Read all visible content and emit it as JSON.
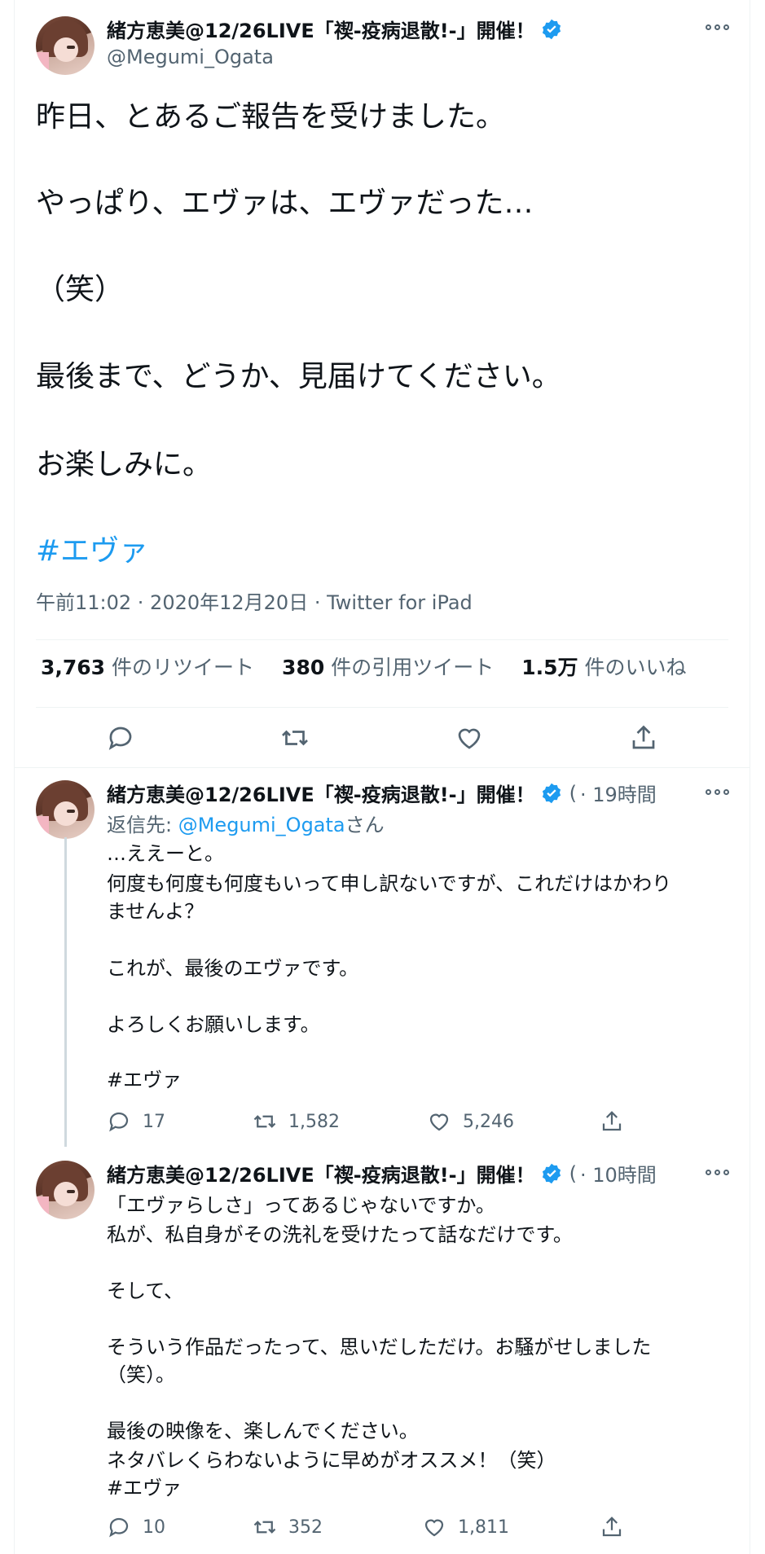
{
  "main_tweet": {
    "author_name": "緒方恵美@12/26LIVE「禊-疫病退散!-」開催！",
    "handle": "@Megumi_Ogata",
    "lines": [
      "昨日、とあるご報告を受けました。",
      "やっぱり、エヴァは、エヴァだった…",
      "（笑）",
      "最後まで、どうか、見届けてください。",
      "お楽しみに。"
    ],
    "hashtag": "#エヴァ",
    "meta": "午前11:02 · 2020年12月20日 · Twitter for iPad",
    "stats": {
      "retweets_count": "3,763",
      "retweets_label": "件のリツイート",
      "quotes_count": "380",
      "quotes_label": "件の引用ツイート",
      "likes_count": "1.5万",
      "likes_label": "件のいいね"
    }
  },
  "reply1": {
    "author_name": "緒方恵美@12/26LIVE「禊-疫病退散!-」開催！",
    "handle_trunc": "(",
    "time": "· 19時間",
    "reply_to_prefix": "返信先: ",
    "reply_to_handle": "@Megumi_Ogata",
    "reply_to_suffix": "さん",
    "lines": [
      "…ええーと。",
      "何度も何度も何度もいって申し訳ないですが、これだけはかわり",
      "ませんよ？",
      "これが、最後のエヴァです。",
      "よろしくお願いします。"
    ],
    "hashtag": "#エヴァ",
    "replies": "17",
    "retweets": "1,582",
    "likes": "5,246"
  },
  "reply2": {
    "author_name": "緒方恵美@12/26LIVE「禊-疫病退散!-」開催！",
    "handle_trunc": "(",
    "time": "· 10時間",
    "lines": [
      "「エヴァらしさ」ってあるじゃないですか。",
      "私が、私自身がその洗礼を受けたって話なだけです。",
      "そして、",
      "そういう作品だったって、思いだしただけ。お騒がせしました",
      "（笑）。",
      "最後の映像を、楽しんでください。",
      "ネタバレくらわないように早めがオススメ！（笑）"
    ],
    "hashtag": "#エヴァ",
    "replies": "10",
    "retweets": "352",
    "likes": "1,811"
  },
  "colors": {
    "accent": "#1d9bf0",
    "text": "#0f1419",
    "secondary": "#536471",
    "divider": "#eff3f4"
  },
  "icons": [
    "verified-badge-icon",
    "more-icon",
    "reply-icon",
    "retweet-icon",
    "like-icon",
    "share-icon"
  ]
}
